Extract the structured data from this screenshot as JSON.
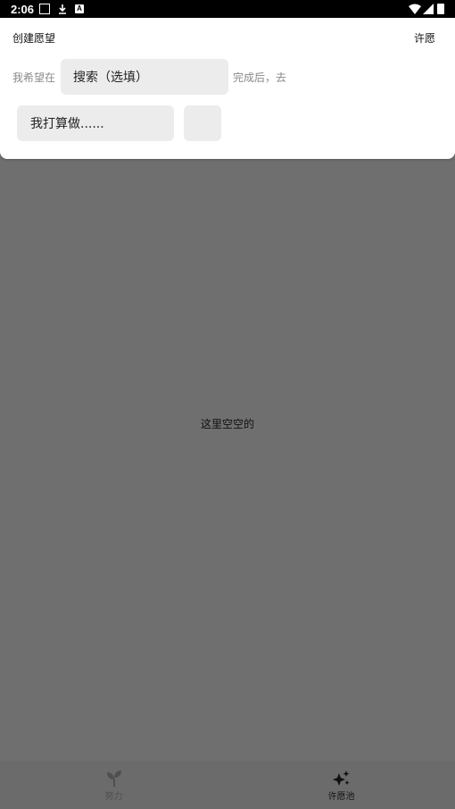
{
  "status_bar": {
    "time": "2:06",
    "icons": [
      "notification-square-icon",
      "download-icon",
      "app-a-icon",
      "wifi-icon",
      "cell-signal-icon",
      "battery-icon"
    ]
  },
  "panel": {
    "title": "创建愿望",
    "action_label": "许愿",
    "prefix_label": "我希望在",
    "search_placeholder": "搜索（选填）",
    "suffix_label": "完成后，去",
    "plan_placeholder": "我打算做......",
    "small_field_value": ""
  },
  "empty_state": {
    "text": "这里空空的"
  },
  "bottom_nav": {
    "items": [
      {
        "label": "努力",
        "icon": "sprout-icon",
        "active": false
      },
      {
        "label": "许愿池",
        "icon": "sparkle-icon",
        "active": true
      }
    ]
  },
  "colors": {
    "overlay": "#6f6f6f",
    "panel_bg": "#ffffff",
    "field_bg": "#ececec",
    "muted_text": "#8a8a8a"
  }
}
